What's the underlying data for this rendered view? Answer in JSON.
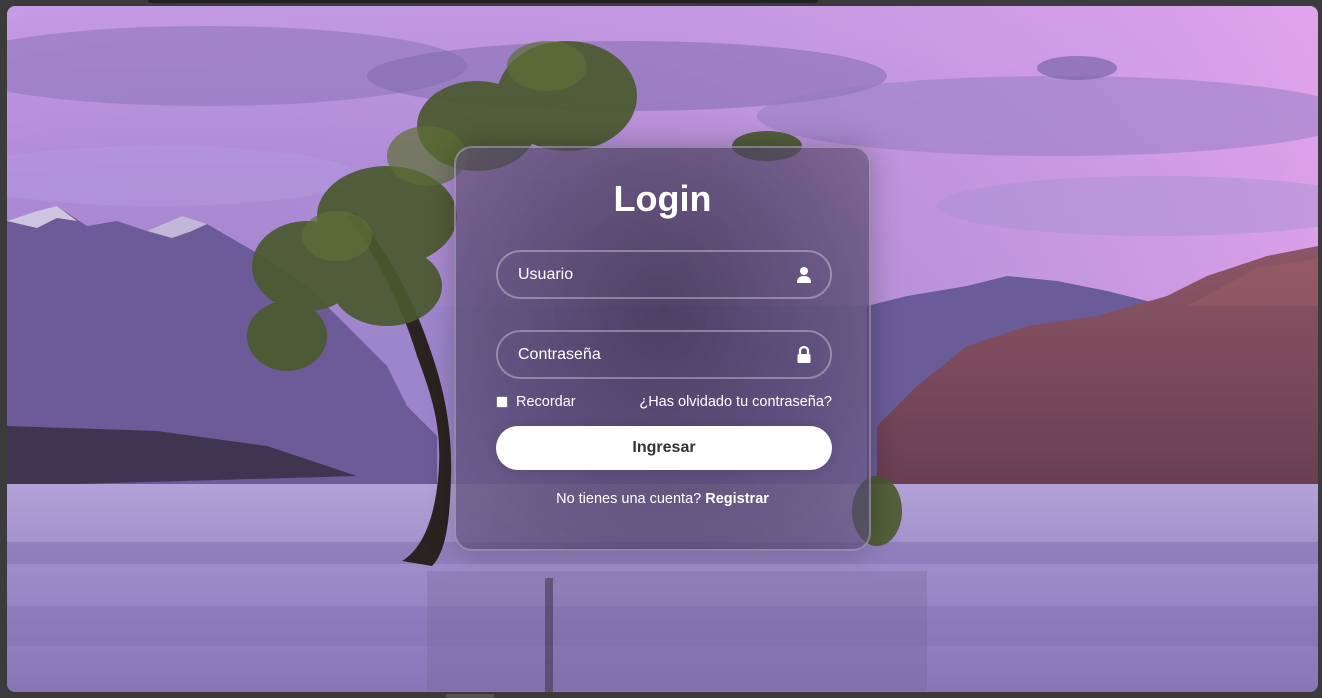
{
  "login": {
    "title": "Login",
    "username": {
      "placeholder": "Usuario",
      "value": ""
    },
    "password": {
      "placeholder": "Contraseña",
      "value": ""
    },
    "remember_label": "Recordar",
    "remember_checked": false,
    "forgot_link": "¿Has olvidado tu contraseña?",
    "submit_label": "Ingresar",
    "register_prompt": "No tienes una cuenta?",
    "register_link": "Registrar"
  },
  "icons": {
    "username": "user-icon",
    "password": "lock-icon"
  },
  "colors": {
    "sky_top": "#e8a8ec",
    "sky_mid": "#a98ad1",
    "mountain": "#6e5a9a",
    "cliff": "#7a4a5a",
    "lake": "#9a86c4",
    "card_border": "#ffffff",
    "button_bg": "#ffffff",
    "button_text": "#333333"
  }
}
